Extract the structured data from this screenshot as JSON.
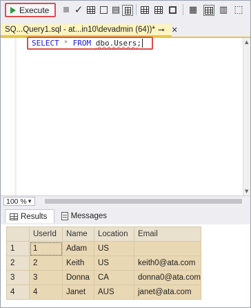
{
  "toolbar": {
    "execute_label": "Execute",
    "icons": [
      "play-icon",
      "stop-icon",
      "checkmark-icon",
      "parse-icon",
      "display-plan-icon",
      "query-options-icon",
      "intellisense-icon",
      "include-plan-icon",
      "client-stats-icon",
      "results-to-text-icon",
      "results-to-grid-icon",
      "results-to-file-icon"
    ]
  },
  "tab": {
    "title": "SQ...Query1.sql - at...in10\\devadmin (64))*",
    "pin": "⊸",
    "close": "✕"
  },
  "editor": {
    "sql": {
      "kw1": "SELECT",
      "star": "*",
      "kw2": "FROM",
      "table": "dbo.Users;"
    }
  },
  "zoom": {
    "value": "100 %"
  },
  "results": {
    "tabs": [
      "Results",
      "Messages"
    ],
    "active_tab": "Results",
    "columns": [
      "UserId",
      "Name",
      "Location",
      "Email"
    ],
    "rows": [
      {
        "row_num": "1",
        "UserId": "1",
        "Name": "Adam",
        "Location": "US",
        "Email": ""
      },
      {
        "row_num": "2",
        "UserId": "2",
        "Name": "Keith",
        "Location": "US",
        "Email": "keith0@ata.com"
      },
      {
        "row_num": "3",
        "UserId": "3",
        "Name": "Donna",
        "Location": "CA",
        "Email": "donna0@ata.com"
      },
      {
        "row_num": "4",
        "UserId": "4",
        "Name": "Janet",
        "Location": "AUS",
        "Email": "janet@ata.com"
      }
    ]
  },
  "colors": {
    "annotation": "#e14b4b",
    "tab_active": "#fdf4bf",
    "keyword": "#1a1ad6",
    "grid_highlight": "#e9d8b4"
  }
}
